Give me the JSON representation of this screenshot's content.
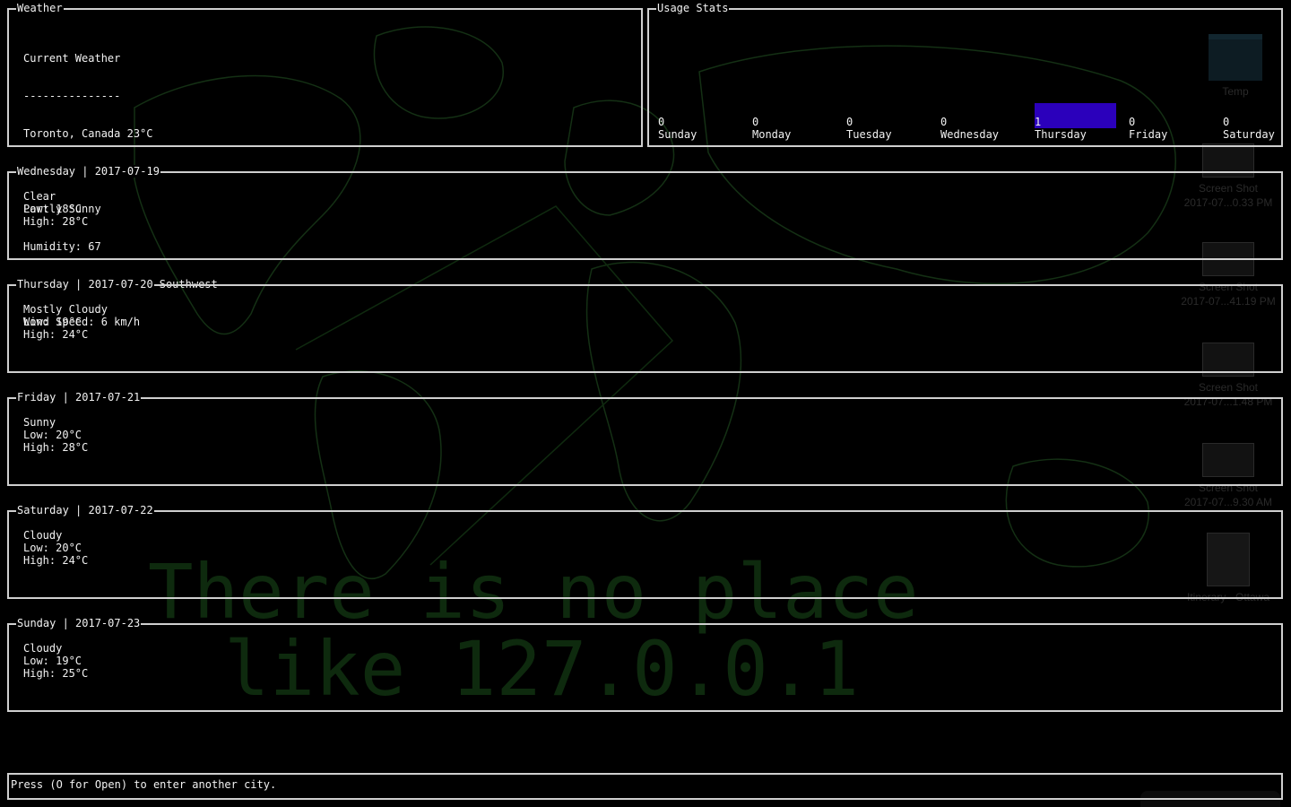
{
  "background": {
    "slogan_line1": "There is no place",
    "slogan_line2": "like 127.0.0.1",
    "slogan_color": "#0e2a0e",
    "map_color": "#143014"
  },
  "desktop": {
    "icons": [
      {
        "name": "Temp",
        "line2": ""
      },
      {
        "name": "Screen Shot",
        "line2": "2017-07...0.33 PM"
      },
      {
        "name": "Screen Shot",
        "line2": "2017-07...41.19 PM"
      },
      {
        "name": "Screen Shot",
        "line2": "2017-07...1.48 PM"
      },
      {
        "name": "Screen Shot",
        "line2": "2017-07...9.30 AM"
      },
      {
        "name": "Itinerary - Ottawa",
        "line2": ""
      }
    ]
  },
  "weather": {
    "title": "Weather",
    "heading": "Current Weather",
    "underline": "---------------",
    "location": "Toronto, Canada 23°C",
    "feels_like": "Feels Like: 23°C",
    "condition": "Partly Sunny",
    "humidity": "Humidity: 67",
    "wind_display": "Wind Display: 6 km/h Southwest",
    "wind_speed": "Wind Speed: 6 km/h"
  },
  "usage": {
    "title": "Usage Stats",
    "bar_color": "#2b00bb",
    "max": 1,
    "days": [
      {
        "label": "Sunday",
        "value": 0
      },
      {
        "label": "Monday",
        "value": 0
      },
      {
        "label": "Tuesday",
        "value": 0
      },
      {
        "label": "Wednesday",
        "value": 0
      },
      {
        "label": "Thursday",
        "value": 1
      },
      {
        "label": "Friday",
        "value": 0
      },
      {
        "label": "Saturday",
        "value": 0
      }
    ]
  },
  "forecast": [
    {
      "title": "Wednesday | 2017-07-19",
      "condition": "Clear",
      "low": "Low: 18°C",
      "high": "High: 28°C"
    },
    {
      "title": "Thursday | 2017-07-20",
      "condition": "Mostly Cloudy",
      "low": "Low: 19°C",
      "high": "High: 24°C"
    },
    {
      "title": "Friday | 2017-07-21",
      "condition": "Sunny",
      "low": "Low: 20°C",
      "high": "High: 28°C"
    },
    {
      "title": "Saturday | 2017-07-22",
      "condition": "Cloudy",
      "low": "Low: 20°C",
      "high": "High: 24°C"
    },
    {
      "title": "Sunday | 2017-07-23",
      "condition": "Cloudy",
      "low": "Low: 19°C",
      "high": "High: 25°C"
    }
  ],
  "footer": {
    "prompt": "Press (O for Open) to enter another city."
  }
}
